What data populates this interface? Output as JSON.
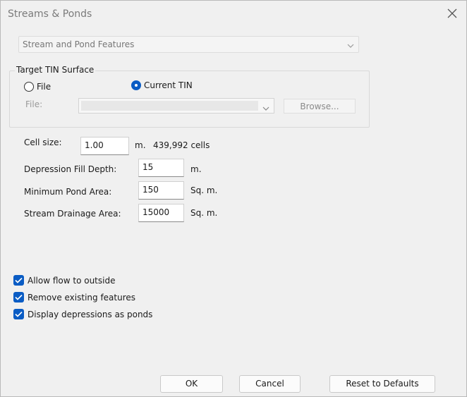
{
  "window": {
    "title": "Streams & Ponds"
  },
  "feature_dropdown": {
    "value": "Stream and Pond Features"
  },
  "target": {
    "group_label": "Target TIN Surface",
    "radio_file": "File",
    "radio_current": "Current TIN",
    "selected": "Current TIN",
    "file_label": "File:",
    "file_value": "",
    "browse_label": "Browse..."
  },
  "params": {
    "cell_size_label": "Cell size:",
    "cell_size_value": "1.00",
    "cell_size_unit": "m.",
    "cell_count": "439,992 cells",
    "depression_label": "Depression Fill Depth:",
    "depression_value": "15",
    "depression_unit": "m.",
    "pond_area_label": "Minimum Pond Area:",
    "pond_area_value": "150",
    "pond_area_unit": "Sq. m.",
    "drainage_label": "Stream Drainage Area:",
    "drainage_value": "15000",
    "drainage_unit": "Sq. m."
  },
  "options": [
    {
      "label": "Allow flow to outside",
      "checked": true
    },
    {
      "label": "Remove existing features",
      "checked": true
    },
    {
      "label": "Display depressions as ponds",
      "checked": true
    }
  ],
  "buttons": {
    "ok": "OK",
    "cancel": "Cancel",
    "reset": "Reset to Defaults"
  },
  "colors": {
    "accent": "#0a5cc4",
    "background": "#f0f0f0"
  },
  "icons": {
    "close": "close-icon",
    "dropdown": "chevron-down-icon",
    "check": "checkmark-icon"
  }
}
